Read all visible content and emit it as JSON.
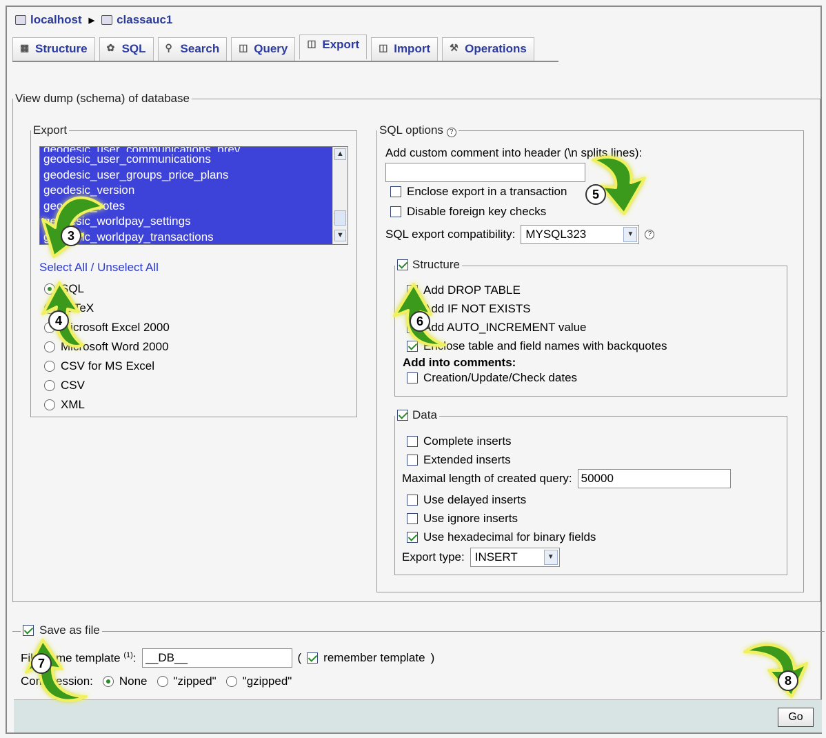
{
  "breadcrumb": {
    "server": "localhost",
    "database": "classauc1"
  },
  "tabs": [
    {
      "label": "Structure",
      "icon": "structure-icon"
    },
    {
      "label": "SQL",
      "icon": "sql-icon"
    },
    {
      "label": "Search",
      "icon": "search-icon"
    },
    {
      "label": "Query",
      "icon": "query-icon"
    },
    {
      "label": "Export",
      "icon": "export-icon",
      "active": true
    },
    {
      "label": "Import",
      "icon": "import-icon"
    },
    {
      "label": "Operations",
      "icon": "wrench-icon"
    }
  ],
  "main_legend": "View dump (schema) of database",
  "export": {
    "legend": "Export",
    "tables": [
      "geodesic_user_communications",
      "geodesic_user_groups_price_plans",
      "geodesic_version",
      "geodesic_votes",
      "geodesic_worldpay_settings",
      "geodesic_worldpay_transactions"
    ],
    "select_all": "Select All",
    "slash": " / ",
    "unselect_all": "Unselect All",
    "formats": [
      "SQL",
      "LaTeX",
      "Microsoft Excel 2000",
      "Microsoft Word 2000",
      "CSV for MS Excel",
      "CSV",
      "XML"
    ],
    "selected_format": "SQL"
  },
  "sql_options": {
    "legend": "SQL options",
    "comment_label": "Add custom comment into header (\\n splits lines):",
    "comment_value": "",
    "enclose_transaction": "Enclose export in a transaction",
    "disable_fk": "Disable foreign key checks",
    "compat_label": "SQL export compatibility:",
    "compat_value": "MYSQL323",
    "structure": {
      "legend": "Structure",
      "add_drop": "Add DROP TABLE",
      "if_not_exists": "Add IF NOT EXISTS",
      "auto_increment": "Add AUTO_INCREMENT value",
      "backquotes": "Enclose table and field names with backquotes",
      "comments_heading": "Add into comments:",
      "dates": "Creation/Update/Check dates"
    },
    "data": {
      "legend": "Data",
      "complete_inserts": "Complete inserts",
      "extended_inserts": "Extended inserts",
      "max_len_label": "Maximal length of created query:",
      "max_len_value": "50000",
      "delayed": "Use delayed inserts",
      "ignore": "Use ignore inserts",
      "hex": "Use hexadecimal for binary fields",
      "export_type_label": "Export type:",
      "export_type_value": "INSERT"
    }
  },
  "save": {
    "legend": "Save as file",
    "template_label": "File name template",
    "template_sup": "(1)",
    "template_colon": ":",
    "template_value": "__DB__",
    "paren_open": "(",
    "remember": "remember template",
    "paren_close": ")",
    "compression_label": "Compression:",
    "compression": [
      "None",
      "\"zipped\"",
      "\"gzipped\""
    ]
  },
  "go_label": "Go",
  "callouts": [
    "3",
    "4",
    "5",
    "6",
    "7",
    "8"
  ],
  "colors": {
    "selection": "#3d43d8",
    "link": "#2a3ad0",
    "arrow": "#3a9a1a",
    "glow": "#f0f060",
    "footer": "#d8e4e4"
  }
}
